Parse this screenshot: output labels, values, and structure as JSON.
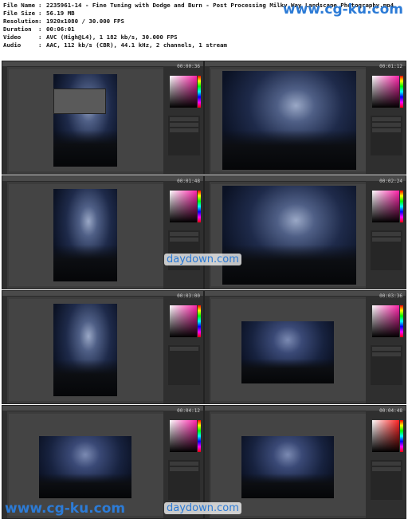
{
  "header_info": [
    {
      "key": "File Name",
      "value": "2235961-14 - Fine Tuning with Dodge and Burn - Post Processing Milky Way Landscape Photography.mp4"
    },
    {
      "key": "File Size",
      "value": "56.19 MB"
    },
    {
      "key": "Resolution",
      "value": "1920x1080 / 30.000 FPS"
    },
    {
      "key": "Duration",
      "value": "00:06:01"
    },
    {
      "key": "Video",
      "value": "AVC (High@L4), 1 182 kb/s, 30.000 FPS"
    },
    {
      "key": "Audio",
      "value": "AAC, 112 kb/s (CBR), 44.1 kHz, 2 channels, 1 stream"
    }
  ],
  "separator": ":",
  "watermarks": {
    "top": "www.cg-ku.com",
    "bottom": "www.cg-ku.com",
    "mid": "daydown.com"
  },
  "thumbnails": [
    {
      "timestamp": "00:00:36"
    },
    {
      "timestamp": "00:01:12"
    },
    {
      "timestamp": "00:01:48"
    },
    {
      "timestamp": "00:02:24"
    },
    {
      "timestamp": "00:03:00"
    },
    {
      "timestamp": "00:03:36"
    },
    {
      "timestamp": "00:04:12"
    },
    {
      "timestamp": "00:04:48"
    }
  ],
  "colors": {
    "watermark": "#2c7bd6",
    "ui_background": "#3c3c3c"
  }
}
